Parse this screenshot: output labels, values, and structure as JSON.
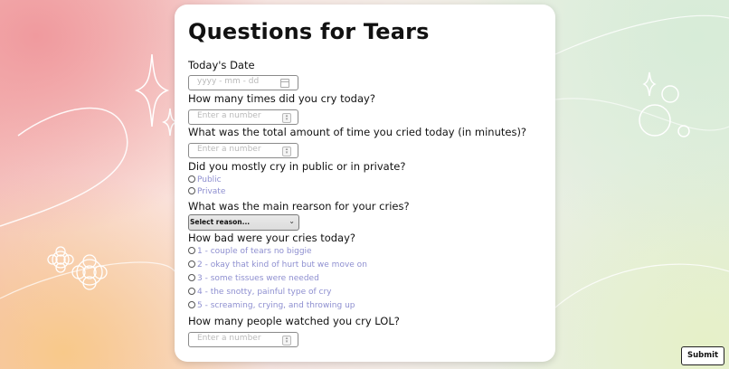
{
  "page": {
    "title": "Questions for Tears"
  },
  "questions": {
    "date": {
      "label": "Today's Date",
      "placeholder": "yyyy - mm - dd"
    },
    "times": {
      "label": "How many times did you cry today?",
      "placeholder": "Enter a number"
    },
    "duration": {
      "label": "What was the total amount of time you cried today (in minutes)?",
      "placeholder": "Enter a number"
    },
    "location": {
      "label": "Did you mostly cry in public or in private?",
      "options": [
        "Public",
        "Private"
      ]
    },
    "reason": {
      "label": "What was the main rearson for your cries?",
      "selected": "Select reason..."
    },
    "severity": {
      "label": "How bad were your cries today?",
      "options": [
        "1 - couple of tears no biggie",
        "2 - okay that kind of hurt but we move on",
        "3 - some tissues were needed",
        "4 - the snotty, painful type of cry",
        "5 - screaming, crying, and throwing up"
      ]
    },
    "watchers": {
      "label": "How many people watched you cry LOL?",
      "placeholder": "Enter a number"
    }
  },
  "actions": {
    "submit_label": "Submit"
  },
  "colors": {
    "option_text": "#8e8fd0",
    "card_bg": "#ffffff"
  },
  "icons": [
    "calendar-icon",
    "spinner-icon",
    "chevron-down-icon",
    "radio-icon",
    "sparkle-icon",
    "flower-icon"
  ]
}
